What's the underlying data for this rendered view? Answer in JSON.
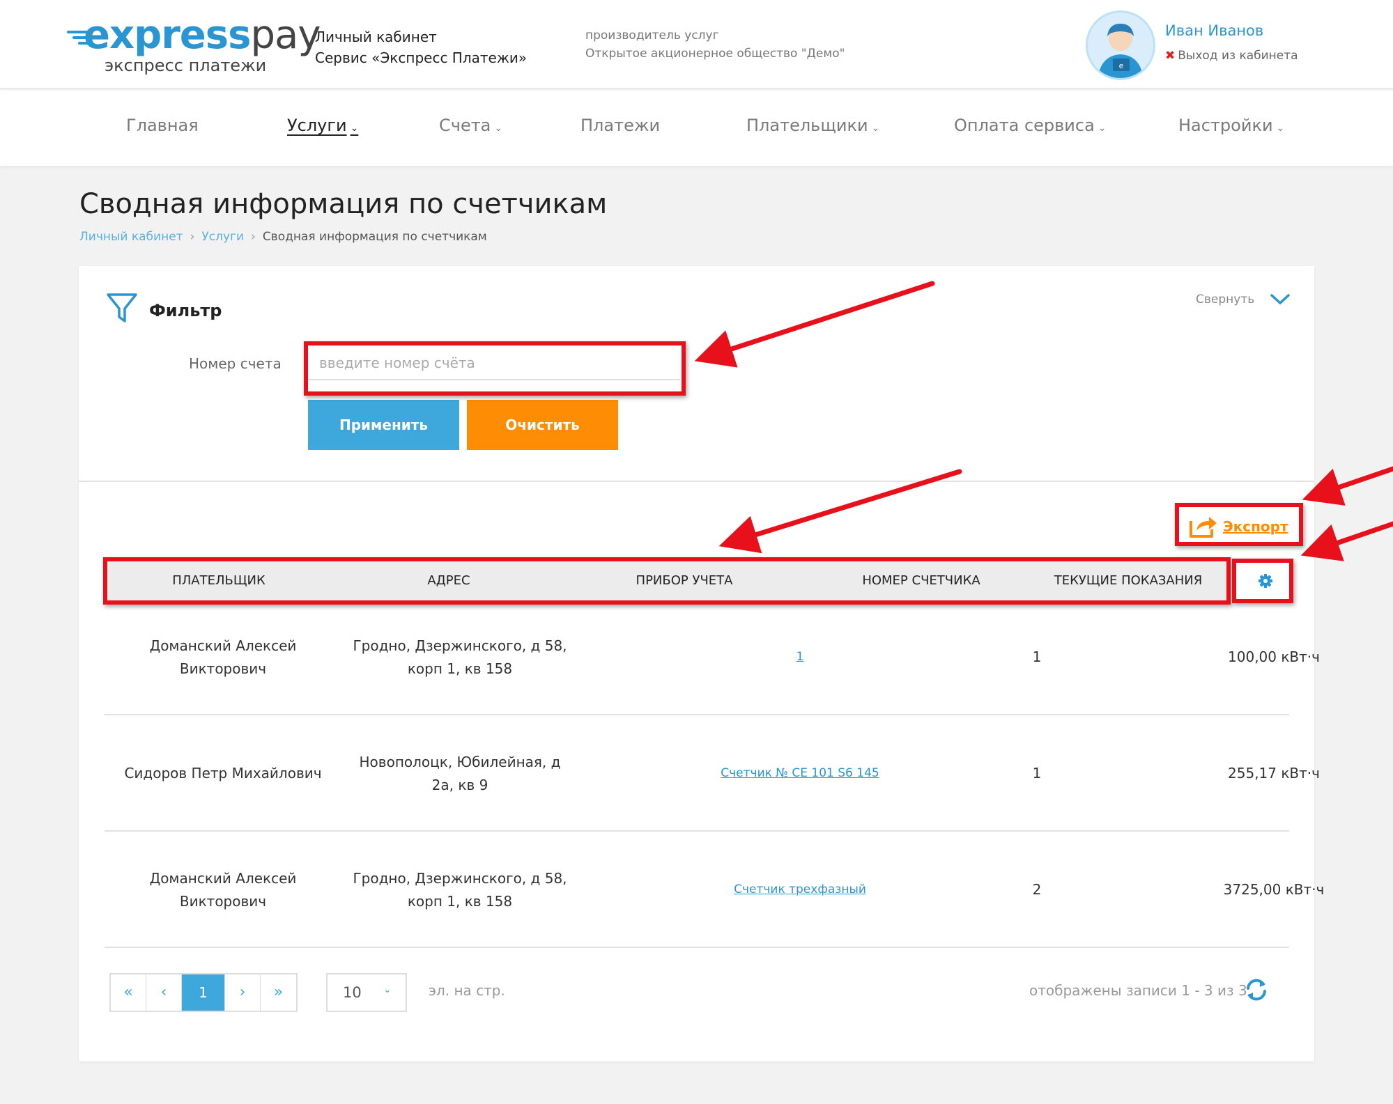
{
  "header": {
    "brand_part1": "express",
    "brand_part2": "pay",
    "brand_tagline": "экспресс платежи",
    "cabinet_line1": "Личный кабинет",
    "cabinet_line2": "Сервис «Экспресс Платежи»",
    "provider_label": "производитель услуг",
    "provider_name": "Открытое акционерное общество \"Демо\"",
    "user_name": "Иван Иванов",
    "logout": "Выход из кабинета"
  },
  "nav": [
    {
      "label": "Главная"
    },
    {
      "label": "Услуги"
    },
    {
      "label": "Счета"
    },
    {
      "label": "Платежи"
    },
    {
      "label": "Плательщики"
    },
    {
      "label": "Оплата сервиса"
    },
    {
      "label": "Настройки"
    }
  ],
  "page": {
    "title": "Сводная информация по счетчикам",
    "breadcrumb": [
      "Личный кабинет",
      "Услуги",
      "Сводная информация по счетчикам"
    ]
  },
  "filter": {
    "title": "Фильтр",
    "collapse_label": "Свернуть",
    "account_label": "Номер счета",
    "account_placeholder": "введите номер счёта",
    "account_value": "",
    "apply_label": "Применить",
    "clear_label": "Очистить"
  },
  "export_label": "Экспорт",
  "table": {
    "columns": [
      "ПЛАТЕЛЬЩИК",
      "АДРЕС",
      "ПРИБОР УЧЕТА",
      "НОМЕР СЧЕТЧИКА",
      "ТЕКУЩИЕ ПОКАЗАНИЯ"
    ],
    "rows": [
      {
        "payer_line1": "Доманский Алексей",
        "payer_line2": "Викторович",
        "address_line1": "Гродно, Дзержинского, д 58,",
        "address_line2": "корп 1, кв 158",
        "device": "1",
        "meter_no": "1",
        "reading": "100,00 кВт·ч"
      },
      {
        "payer_line1": "Сидоров Петр Михайлович",
        "payer_line2": "",
        "address_line1": "Новополоцк, Юбилейная, д",
        "address_line2": "2а, кв 9",
        "device": "Счетчик № CE 101 S6 145",
        "meter_no": "1",
        "reading": "255,17 кВт·ч"
      },
      {
        "payer_line1": "Доманский Алексей",
        "payer_line2": "Викторович",
        "address_line1": "Гродно, Дзержинского, д 58,",
        "address_line2": "корп 1, кв 158",
        "device": "Счетчик трехфазный",
        "meter_no": "2",
        "reading": "3725,00 кВт·ч"
      }
    ]
  },
  "pagination": {
    "current_page": "1",
    "per_page": "10",
    "per_page_label": "эл. на стр.",
    "records_info": "отображены записи 1 - 3 из 3"
  },
  "icons": {
    "filter": "filter-icon",
    "collapse": "chevron-down-icon",
    "export": "export-share-icon",
    "settings": "gear-icon",
    "refresh": "refresh-icon",
    "avatar": "user-avatar-icon"
  },
  "colors": {
    "accent_blue": "#3ea8dc",
    "accent_orange": "#ff8c05",
    "annotation_red": "#e8101a"
  }
}
